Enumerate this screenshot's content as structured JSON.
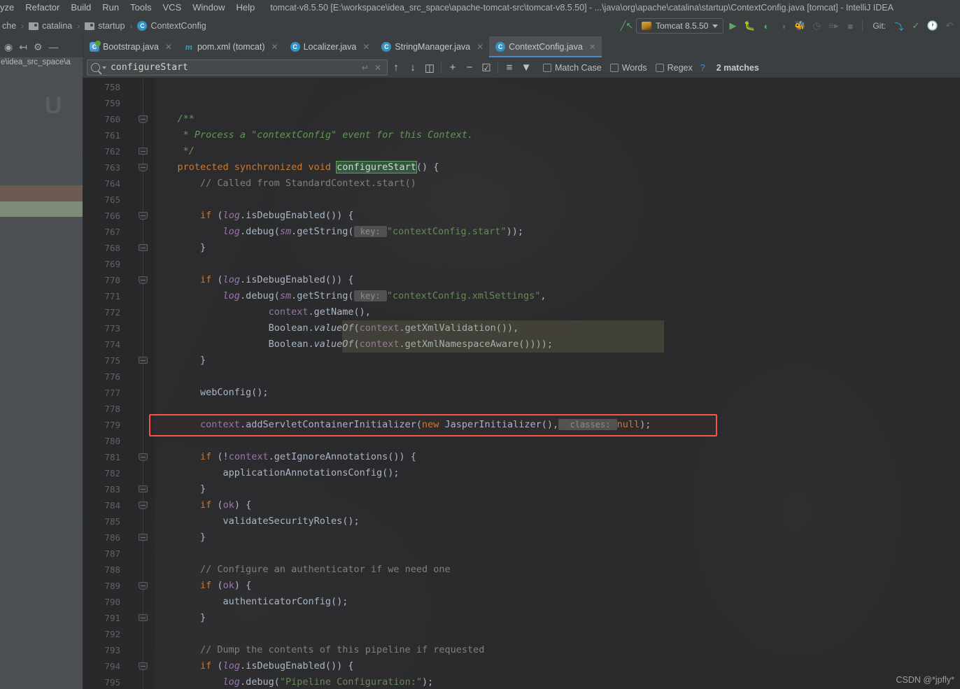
{
  "window": {
    "title": "tomcat-v8.5.50 [E:\\workspace\\idea_src_space\\apache-tomcat-src\\tomcat-v8.5.50] - ...\\java\\org\\apache\\catalina\\startup\\ContextConfig.java [tomcat] - IntelliJ IDEA",
    "accent_blue": "#4a88c7",
    "accent_green": "#59a869",
    "annotation_red": "#f4564a",
    "editor_bg": "#2b2b2b"
  },
  "menubar": {
    "items": [
      {
        "label": "yze"
      },
      {
        "label": "Refactor"
      },
      {
        "label": "Build"
      },
      {
        "label": "Run"
      },
      {
        "label": "Tools"
      },
      {
        "label": "VCS"
      },
      {
        "label": "Window"
      },
      {
        "label": "Help"
      }
    ]
  },
  "navbar": {
    "crumbs": [
      {
        "label": "che",
        "icon": "none"
      },
      {
        "label": "catalina",
        "icon": "folder-icon"
      },
      {
        "label": "startup",
        "icon": "folder-icon"
      },
      {
        "label": "ContextConfig",
        "icon": "class-icon",
        "icon_letter": "C"
      }
    ],
    "separator": "›",
    "run_config": {
      "label": "Tomcat 8.5.50",
      "icon": "tomcat-icon"
    },
    "git_label": "Git:",
    "toolbar_icons": [
      "build-hammer-icon",
      "run-icon",
      "debug-icon",
      "run-with-coverage-icon",
      "profile-icon",
      "attach-debugger-icon",
      "rerun-icon",
      "run-dashboard-icon",
      "stop-icon",
      "git-update-icon",
      "git-commit-icon",
      "git-history-icon",
      "git-rollback-icon"
    ]
  },
  "panel_toolbar": {
    "icons": [
      "locate-target-icon",
      "collapse-all-icon",
      "gear-icon",
      "hide-panel-icon"
    ]
  },
  "tabs": [
    {
      "label": "Bootstrap.java",
      "icon": "java-run-class-icon",
      "icon_letter": "C",
      "active": false
    },
    {
      "label": "pom.xml (tomcat)",
      "icon": "maven-icon",
      "icon_letter": "m",
      "active": false
    },
    {
      "label": "Localizer.java",
      "icon": "java-class-icon",
      "icon_letter": "C",
      "active": false
    },
    {
      "label": "StringManager.java",
      "icon": "java-class-icon",
      "icon_letter": "C",
      "active": false
    },
    {
      "label": "ContextConfig.java",
      "icon": "java-class-icon",
      "icon_letter": "C",
      "active": true
    }
  ],
  "search": {
    "value": "configureStart",
    "placeholder": "Search",
    "icons_left": [
      "search-icon",
      "search-history-chevron-icon"
    ],
    "icons_infield": [
      "multiline-toggle-icon",
      "clear-icon"
    ],
    "nav_icons": [
      "find-previous-icon",
      "find-next-icon",
      "select-all-occurrences-icon"
    ],
    "edit_icons": [
      "add-line-icon",
      "remove-line-icon",
      "toggle-selection-icon"
    ],
    "filter_icons": [
      "in-selection-icon",
      "filter-icon"
    ],
    "options": [
      {
        "label": "Match Case",
        "mnemonic": "C",
        "checked": false
      },
      {
        "label": "Words",
        "mnemonic": "o",
        "checked": false
      },
      {
        "label": "Regex",
        "mnemonic": "x",
        "checked": false
      }
    ],
    "help": "?",
    "status": "2 matches"
  },
  "left_panel": {
    "path_fragment": "e\\idea_src_space\\a",
    "watermark_letter": "U"
  },
  "editor": {
    "first_line": 758,
    "highlight_term": "configureStart",
    "highlighted_lines": [
      773,
      774
    ],
    "annotated_line": 779,
    "annotation_shape": "red-rectangle",
    "lines": [
      {
        "n": 758,
        "tokens": []
      },
      {
        "n": 759,
        "tokens": []
      },
      {
        "n": 760,
        "fold": "open",
        "tokens": [
          {
            "t": "    ",
            "c": ""
          },
          {
            "t": "/**",
            "c": "jdoc"
          }
        ]
      },
      {
        "n": 761,
        "tokens": [
          {
            "t": "     * Process a \"contextConfig\" event for this Context.",
            "c": "jdoc"
          }
        ]
      },
      {
        "n": 762,
        "fold": "close",
        "tokens": [
          {
            "t": "     */",
            "c": "jdoc"
          }
        ]
      },
      {
        "n": 763,
        "fold": "open",
        "tokens": [
          {
            "t": "    ",
            "c": ""
          },
          {
            "t": "protected synchronized void ",
            "c": "kw"
          },
          {
            "t": "configureStart",
            "c": "hl-search"
          },
          {
            "t": "() {",
            "c": ""
          }
        ]
      },
      {
        "n": 764,
        "tokens": [
          {
            "t": "        // Called from StandardContext.start()",
            "c": "cmt"
          }
        ]
      },
      {
        "n": 765,
        "tokens": []
      },
      {
        "n": 766,
        "fold": "open",
        "tokens": [
          {
            "t": "        ",
            "c": ""
          },
          {
            "t": "if",
            "c": "kw"
          },
          {
            "t": " (",
            "c": ""
          },
          {
            "t": "log",
            "c": "sfld"
          },
          {
            "t": ".isDebugEnabled()) {",
            "c": ""
          }
        ]
      },
      {
        "n": 767,
        "tokens": [
          {
            "t": "            ",
            "c": ""
          },
          {
            "t": "log",
            "c": "sfld"
          },
          {
            "t": ".debug(",
            "c": ""
          },
          {
            "t": "sm",
            "c": "sfld"
          },
          {
            "t": ".getString(",
            "c": ""
          },
          {
            "t": " key: ",
            "c": "hint"
          },
          {
            "t": "\"contextConfig.start\"",
            "c": "str"
          },
          {
            "t": "));",
            "c": ""
          }
        ]
      },
      {
        "n": 768,
        "fold": "close",
        "tokens": [
          {
            "t": "        }",
            "c": ""
          }
        ]
      },
      {
        "n": 769,
        "tokens": []
      },
      {
        "n": 770,
        "fold": "open",
        "tokens": [
          {
            "t": "        ",
            "c": ""
          },
          {
            "t": "if",
            "c": "kw"
          },
          {
            "t": " (",
            "c": ""
          },
          {
            "t": "log",
            "c": "sfld"
          },
          {
            "t": ".isDebugEnabled()) {",
            "c": ""
          }
        ]
      },
      {
        "n": 771,
        "tokens": [
          {
            "t": "            ",
            "c": ""
          },
          {
            "t": "log",
            "c": "sfld"
          },
          {
            "t": ".debug(",
            "c": ""
          },
          {
            "t": "sm",
            "c": "sfld"
          },
          {
            "t": ".getString(",
            "c": ""
          },
          {
            "t": " key: ",
            "c": "hint"
          },
          {
            "t": "\"contextConfig.xmlSettings\"",
            "c": "str"
          },
          {
            "t": ",",
            "c": ""
          }
        ]
      },
      {
        "n": 772,
        "tokens": [
          {
            "t": "                    ",
            "c": ""
          },
          {
            "t": "context",
            "c": "fld"
          },
          {
            "t": ".getName(),",
            "c": ""
          }
        ]
      },
      {
        "n": 773,
        "band": true,
        "tokens": [
          {
            "t": "                    ",
            "c": ""
          },
          {
            "t": "Boolean.",
            "c": ""
          },
          {
            "t": "valueOf",
            "c": "stat"
          },
          {
            "t": "(",
            "c": ""
          },
          {
            "t": "context",
            "c": "fld"
          },
          {
            "t": ".getXmlValidation()),",
            "c": ""
          }
        ]
      },
      {
        "n": 774,
        "band": true,
        "tokens": [
          {
            "t": "                    ",
            "c": ""
          },
          {
            "t": "Boolean.",
            "c": ""
          },
          {
            "t": "valueOf",
            "c": "stat"
          },
          {
            "t": "(",
            "c": ""
          },
          {
            "t": "context",
            "c": "fld"
          },
          {
            "t": ".getXmlNamespaceAware())));",
            "c": ""
          }
        ]
      },
      {
        "n": 775,
        "fold": "close",
        "tokens": [
          {
            "t": "        }",
            "c": ""
          }
        ]
      },
      {
        "n": 776,
        "tokens": []
      },
      {
        "n": 777,
        "tokens": [
          {
            "t": "        webConfig();",
            "c": ""
          }
        ]
      },
      {
        "n": 778,
        "tokens": []
      },
      {
        "n": 779,
        "annotated": true,
        "tokens": [
          {
            "t": "        ",
            "c": ""
          },
          {
            "t": "context",
            "c": "fld"
          },
          {
            "t": ".addServletContainerInitializer(",
            "c": ""
          },
          {
            "t": "new",
            "c": "kw"
          },
          {
            "t": " JasperInitializer(),",
            "c": ""
          },
          {
            "t": "  classes: ",
            "c": "hint"
          },
          {
            "t": "null",
            "c": "kw"
          },
          {
            "t": ");",
            "c": ""
          }
        ]
      },
      {
        "n": 780,
        "tokens": []
      },
      {
        "n": 781,
        "fold": "open",
        "tokens": [
          {
            "t": "        ",
            "c": ""
          },
          {
            "t": "if",
            "c": "kw"
          },
          {
            "t": " (!",
            "c": ""
          },
          {
            "t": "context",
            "c": "fld"
          },
          {
            "t": ".getIgnoreAnnotations()) {",
            "c": ""
          }
        ]
      },
      {
        "n": 782,
        "tokens": [
          {
            "t": "            applicationAnnotationsConfig();",
            "c": ""
          }
        ]
      },
      {
        "n": 783,
        "fold": "close",
        "tokens": [
          {
            "t": "        }",
            "c": ""
          }
        ]
      },
      {
        "n": 784,
        "fold": "open",
        "tokens": [
          {
            "t": "        ",
            "c": ""
          },
          {
            "t": "if",
            "c": "kw"
          },
          {
            "t": " (",
            "c": ""
          },
          {
            "t": "ok",
            "c": "fld"
          },
          {
            "t": ") {",
            "c": ""
          }
        ]
      },
      {
        "n": 785,
        "tokens": [
          {
            "t": "            validateSecurityRoles();",
            "c": ""
          }
        ]
      },
      {
        "n": 786,
        "fold": "close",
        "tokens": [
          {
            "t": "        }",
            "c": ""
          }
        ]
      },
      {
        "n": 787,
        "tokens": []
      },
      {
        "n": 788,
        "tokens": [
          {
            "t": "        // Configure an authenticator if we need one",
            "c": "cmt"
          }
        ]
      },
      {
        "n": 789,
        "fold": "open",
        "tokens": [
          {
            "t": "        ",
            "c": ""
          },
          {
            "t": "if",
            "c": "kw"
          },
          {
            "t": " (",
            "c": ""
          },
          {
            "t": "ok",
            "c": "fld"
          },
          {
            "t": ") {",
            "c": ""
          }
        ]
      },
      {
        "n": 790,
        "tokens": [
          {
            "t": "            authenticatorConfig();",
            "c": ""
          }
        ]
      },
      {
        "n": 791,
        "fold": "close",
        "tokens": [
          {
            "t": "        }",
            "c": ""
          }
        ]
      },
      {
        "n": 792,
        "tokens": []
      },
      {
        "n": 793,
        "tokens": [
          {
            "t": "        // Dump the contents of this pipeline if requested",
            "c": "cmt"
          }
        ]
      },
      {
        "n": 794,
        "fold": "open",
        "tokens": [
          {
            "t": "        ",
            "c": ""
          },
          {
            "t": "if",
            "c": "kw"
          },
          {
            "t": " (",
            "c": ""
          },
          {
            "t": "log",
            "c": "sfld"
          },
          {
            "t": ".isDebugEnabled()) {",
            "c": ""
          }
        ]
      },
      {
        "n": 795,
        "tokens": [
          {
            "t": "            ",
            "c": ""
          },
          {
            "t": "log",
            "c": "sfld"
          },
          {
            "t": ".debug(",
            "c": ""
          },
          {
            "t": "\"Pipeline Configuration:\"",
            "c": "str"
          },
          {
            "t": ");",
            "c": ""
          }
        ]
      }
    ]
  },
  "watermark": {
    "text": "CSDN @*jpfly*"
  }
}
